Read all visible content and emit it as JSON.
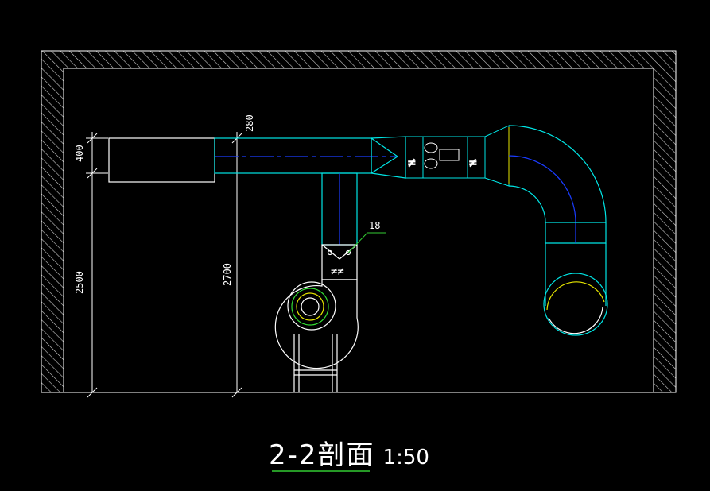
{
  "drawing": {
    "title": "2-2剖面",
    "scale": "1:50",
    "dimensions": {
      "d400": "400",
      "d2500": "2500",
      "d280": "280",
      "d2700": "2700"
    },
    "callout": "18",
    "colors": {
      "background": "#000000",
      "outline": "#ffffff",
      "duct": "#00e5e5",
      "centerline": "#1a3cff",
      "fitting": "#e6e600",
      "fan": "#33dd33",
      "leader": "#33cc33"
    }
  }
}
